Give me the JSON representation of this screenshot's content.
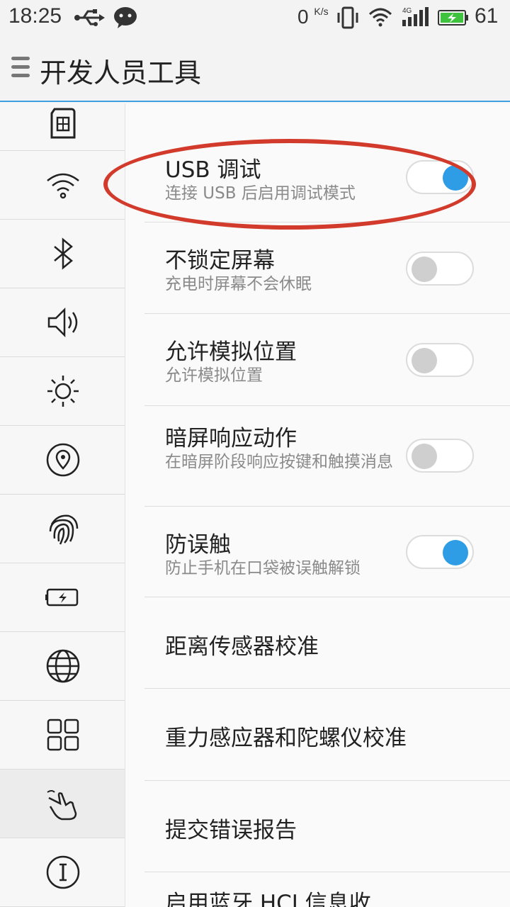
{
  "status_bar": {
    "time": "18:25",
    "net_speed": "0",
    "net_unit": "K/s",
    "network_type": "4G",
    "battery_level": "61",
    "icons": [
      "usb-icon",
      "wechat-icon",
      "vibrate-icon",
      "wifi-icon",
      "signal-icon",
      "battery-icon"
    ]
  },
  "header": {
    "title": "开发人员工具"
  },
  "sidebar": {
    "items": [
      {
        "icon": "sim-card-icon"
      },
      {
        "icon": "wifi-icon"
      },
      {
        "icon": "bluetooth-icon"
      },
      {
        "icon": "sound-icon"
      },
      {
        "icon": "brightness-icon"
      },
      {
        "icon": "location-icon"
      },
      {
        "icon": "fingerprint-icon"
      },
      {
        "icon": "battery-icon"
      },
      {
        "icon": "globe-icon"
      },
      {
        "icon": "apps-grid-icon"
      },
      {
        "icon": "gesture-hand-icon",
        "active": true
      },
      {
        "icon": "info-icon"
      }
    ]
  },
  "settings": [
    {
      "title": "USB 调试",
      "subtitle": "连接 USB 后启用调试模式",
      "toggle": "on"
    },
    {
      "title": "不锁定屏幕",
      "subtitle": "充电时屏幕不会休眠",
      "toggle": "off"
    },
    {
      "title": "允许模拟位置",
      "subtitle": "允许模拟位置",
      "toggle": "off"
    },
    {
      "title": "暗屏响应动作",
      "subtitle": "在暗屏阶段响应按键和触摸消息",
      "toggle": "off"
    },
    {
      "title": "防误触",
      "subtitle": "防止手机在口袋被误触解锁",
      "toggle": "on"
    },
    {
      "title": "距离传感器校准"
    },
    {
      "title": "重力感应器和陀螺仪校准"
    },
    {
      "title": "提交错误报告"
    },
    {
      "title": "启用蓝牙 HCI 信息收"
    }
  ],
  "colors": {
    "accent": "#2f9de5",
    "annotation": "#d23b2c",
    "toggle_off_knob": "#cfcfcf"
  }
}
